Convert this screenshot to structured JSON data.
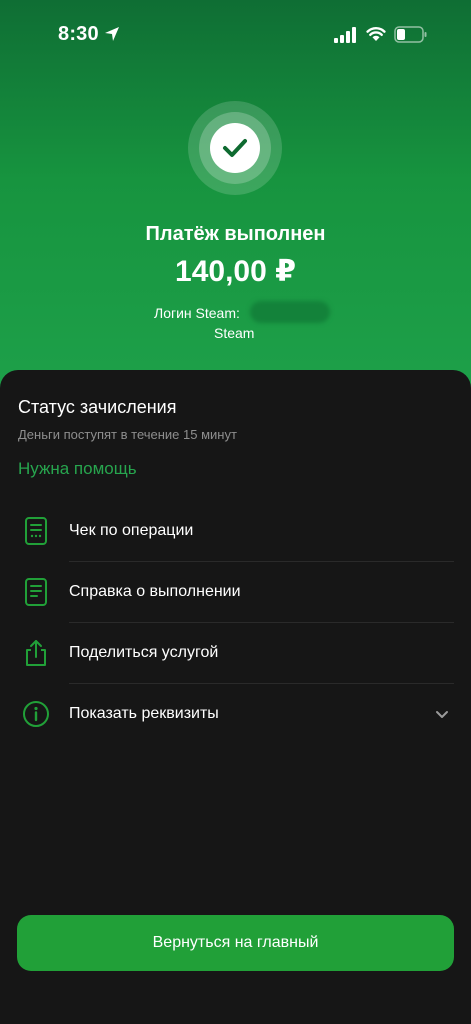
{
  "status_bar": {
    "time": "8:30",
    "icons": [
      "location-arrow-icon",
      "cellular-signal-icon",
      "wifi-icon",
      "battery-icon"
    ]
  },
  "success": {
    "icon": "checkmark-icon",
    "title": "Платёж выполнен",
    "amount": "140,00 ₽",
    "login_label": "Логин Steam:",
    "login_service": "Steam"
  },
  "sheet": {
    "title": "Статус зачисления",
    "subtitle": "Деньги поступят в течение 15 минут",
    "help_link": "Нужна помощь",
    "items": [
      {
        "label": "Чек по операции",
        "icon": "receipt-icon"
      },
      {
        "label": "Справка о выполнении",
        "icon": "document-icon"
      },
      {
        "label": "Поделиться услугой",
        "icon": "share-icon"
      },
      {
        "label": "Показать реквизиты",
        "icon": "info-icon"
      }
    ],
    "home_button": "Вернуться на главный"
  },
  "colors": {
    "accent_green": "#21a038",
    "link_green": "#27a54e",
    "sheet_bg": "#161616"
  }
}
